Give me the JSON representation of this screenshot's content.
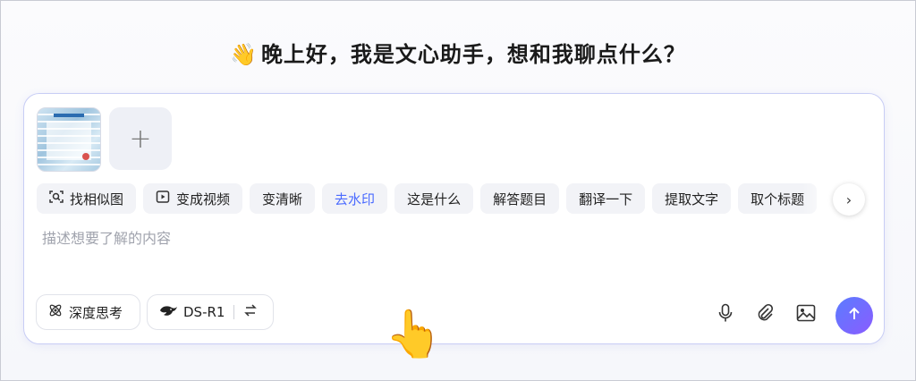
{
  "greeting": {
    "emoji": "👋",
    "text": "晚上好，我是文心助手，想和我聊点什么？"
  },
  "upload": {
    "add_label": "+"
  },
  "chips": [
    {
      "label": "找相似图",
      "icon": "image-search-icon"
    },
    {
      "label": "变成视频",
      "icon": "video-icon"
    },
    {
      "label": "变清晰",
      "icon": ""
    },
    {
      "label": "去水印",
      "icon": "",
      "active": true
    },
    {
      "label": "这是什么",
      "icon": ""
    },
    {
      "label": "解答题目",
      "icon": ""
    },
    {
      "label": "翻译一下",
      "icon": ""
    },
    {
      "label": "提取文字",
      "icon": ""
    },
    {
      "label": "取个标题",
      "icon": ""
    }
  ],
  "input": {
    "placeholder": "描述想要了解的内容"
  },
  "toolbar": {
    "deep_think_label": "深度思考",
    "model_label": "DS-R1"
  },
  "colors": {
    "accent": "#4b6bff",
    "send_gradient_start": "#5b7cff",
    "send_gradient_end": "#8a5cff"
  }
}
